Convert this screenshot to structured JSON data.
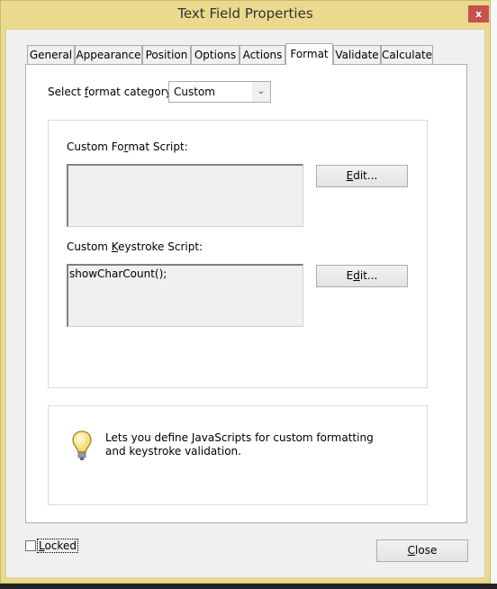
{
  "window": {
    "title": "Text Field Properties",
    "close_label": "x"
  },
  "tabs": [
    {
      "label": "General",
      "selected": false
    },
    {
      "label": "Appearance",
      "selected": false
    },
    {
      "label": "Position",
      "selected": false
    },
    {
      "label": "Options",
      "selected": false
    },
    {
      "label": "Actions",
      "selected": false
    },
    {
      "label": "Format",
      "selected": true
    },
    {
      "label": "Validate",
      "selected": false
    },
    {
      "label": "Calculate",
      "selected": false
    }
  ],
  "format": {
    "category_label": {
      "pre": "Select ",
      "key": "f",
      "post": "ormat category:"
    },
    "category_value": "Custom",
    "format_script_label": {
      "pre": "Custom Fo",
      "key": "r",
      "post": "mat Script:"
    },
    "format_script_value": "",
    "format_edit": {
      "pre": "",
      "key": "E",
      "post": "dit..."
    },
    "keystroke_script_label": {
      "pre": "Custom ",
      "key": "K",
      "post": "eystroke Script:"
    },
    "keystroke_script_value": "showCharCount();",
    "keystroke_edit": {
      "pre": "E",
      "key": "d",
      "post": "it..."
    },
    "info_text": "Lets you define JavaScripts for custom formatting and keystroke validation.",
    "info_icon": "lightbulb-icon"
  },
  "footer": {
    "locked": {
      "pre": "",
      "key": "L",
      "post": "ocked",
      "checked": false
    },
    "close": {
      "pre": "",
      "key": "C",
      "post": "lose"
    }
  },
  "colors": {
    "titlebar": "#ebd98d",
    "close_button": "#c75050"
  }
}
